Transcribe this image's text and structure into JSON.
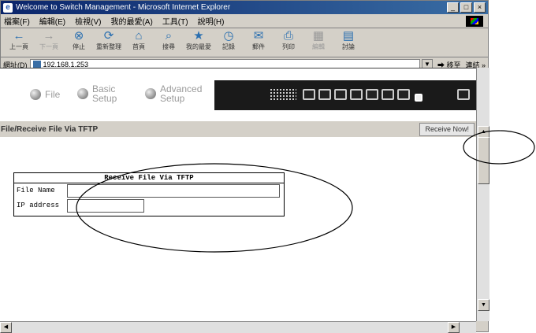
{
  "window": {
    "title": "Welcome to Switch Management - Microsoft Internet Explorer"
  },
  "menu": [
    "檔案(F)",
    "編輯(E)",
    "檢視(V)",
    "我的最愛(A)",
    "工具(T)",
    "說明(H)"
  ],
  "toolbar": [
    {
      "icon": "back-icon",
      "label": "上一頁"
    },
    {
      "icon": "forward-icon",
      "label": "下一頁"
    },
    {
      "icon": "stop-icon",
      "label": "停止"
    },
    {
      "icon": "refresh-icon",
      "label": "重新整理"
    },
    {
      "icon": "home-icon",
      "label": "首頁"
    },
    {
      "icon": "search-icon",
      "label": "搜尋"
    },
    {
      "icon": "favorites-icon",
      "label": "我的最愛"
    },
    {
      "icon": "history-icon",
      "label": "記錄"
    },
    {
      "icon": "mail-icon",
      "label": "郵件"
    },
    {
      "icon": "print-icon",
      "label": "列印"
    },
    {
      "icon": "edit-icon",
      "label": "編輯"
    },
    {
      "icon": "discuss-icon",
      "label": "討論"
    }
  ],
  "address": {
    "label": "網址(D)",
    "url": "192.168.1.253",
    "go": "移至",
    "links": "連結"
  },
  "nav": {
    "file": "File",
    "basic": "Basic Setup",
    "advanced": "Advanced Setup"
  },
  "page": {
    "heading": "File/Receive File Via TFTP",
    "receive_button": "Receive Now!"
  },
  "form": {
    "title": "Receive File Via TFTP",
    "file_name_label": "File Name",
    "ip_label": "IP address",
    "file_name_value": "",
    "ip_value": ""
  }
}
